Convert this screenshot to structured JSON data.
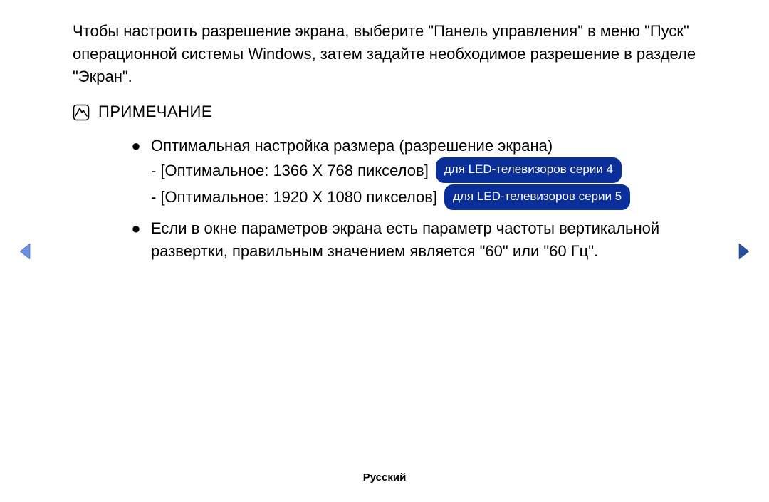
{
  "intro": "Чтобы настроить разрешение экрана, выберите \"Панель управления\" в меню \"Пуск\" операционной системы Windows, затем задайте необходимое разрешение в разделе \"Экран\".",
  "note_title": "ПРИМЕЧАНИЕ",
  "bullets": [
    {
      "text": "Оптимальная настройка размера (разрешение экрана)",
      "sub": [
        {
          "text": "- [Оптимальное: 1366 X 768 пикселов]",
          "badge": "для LED-телевизоров серии 4"
        },
        {
          "text": "- [Оптимальное: 1920 X 1080 пикселов]",
          "badge": "для LED-телевизоров серии 5"
        }
      ]
    },
    {
      "text": "Если в окне параметров экрана есть параметр частоты вертикальной развертки, правильным значением является \"60\" или \"60 Гц\"."
    }
  ],
  "footer": "Русский"
}
